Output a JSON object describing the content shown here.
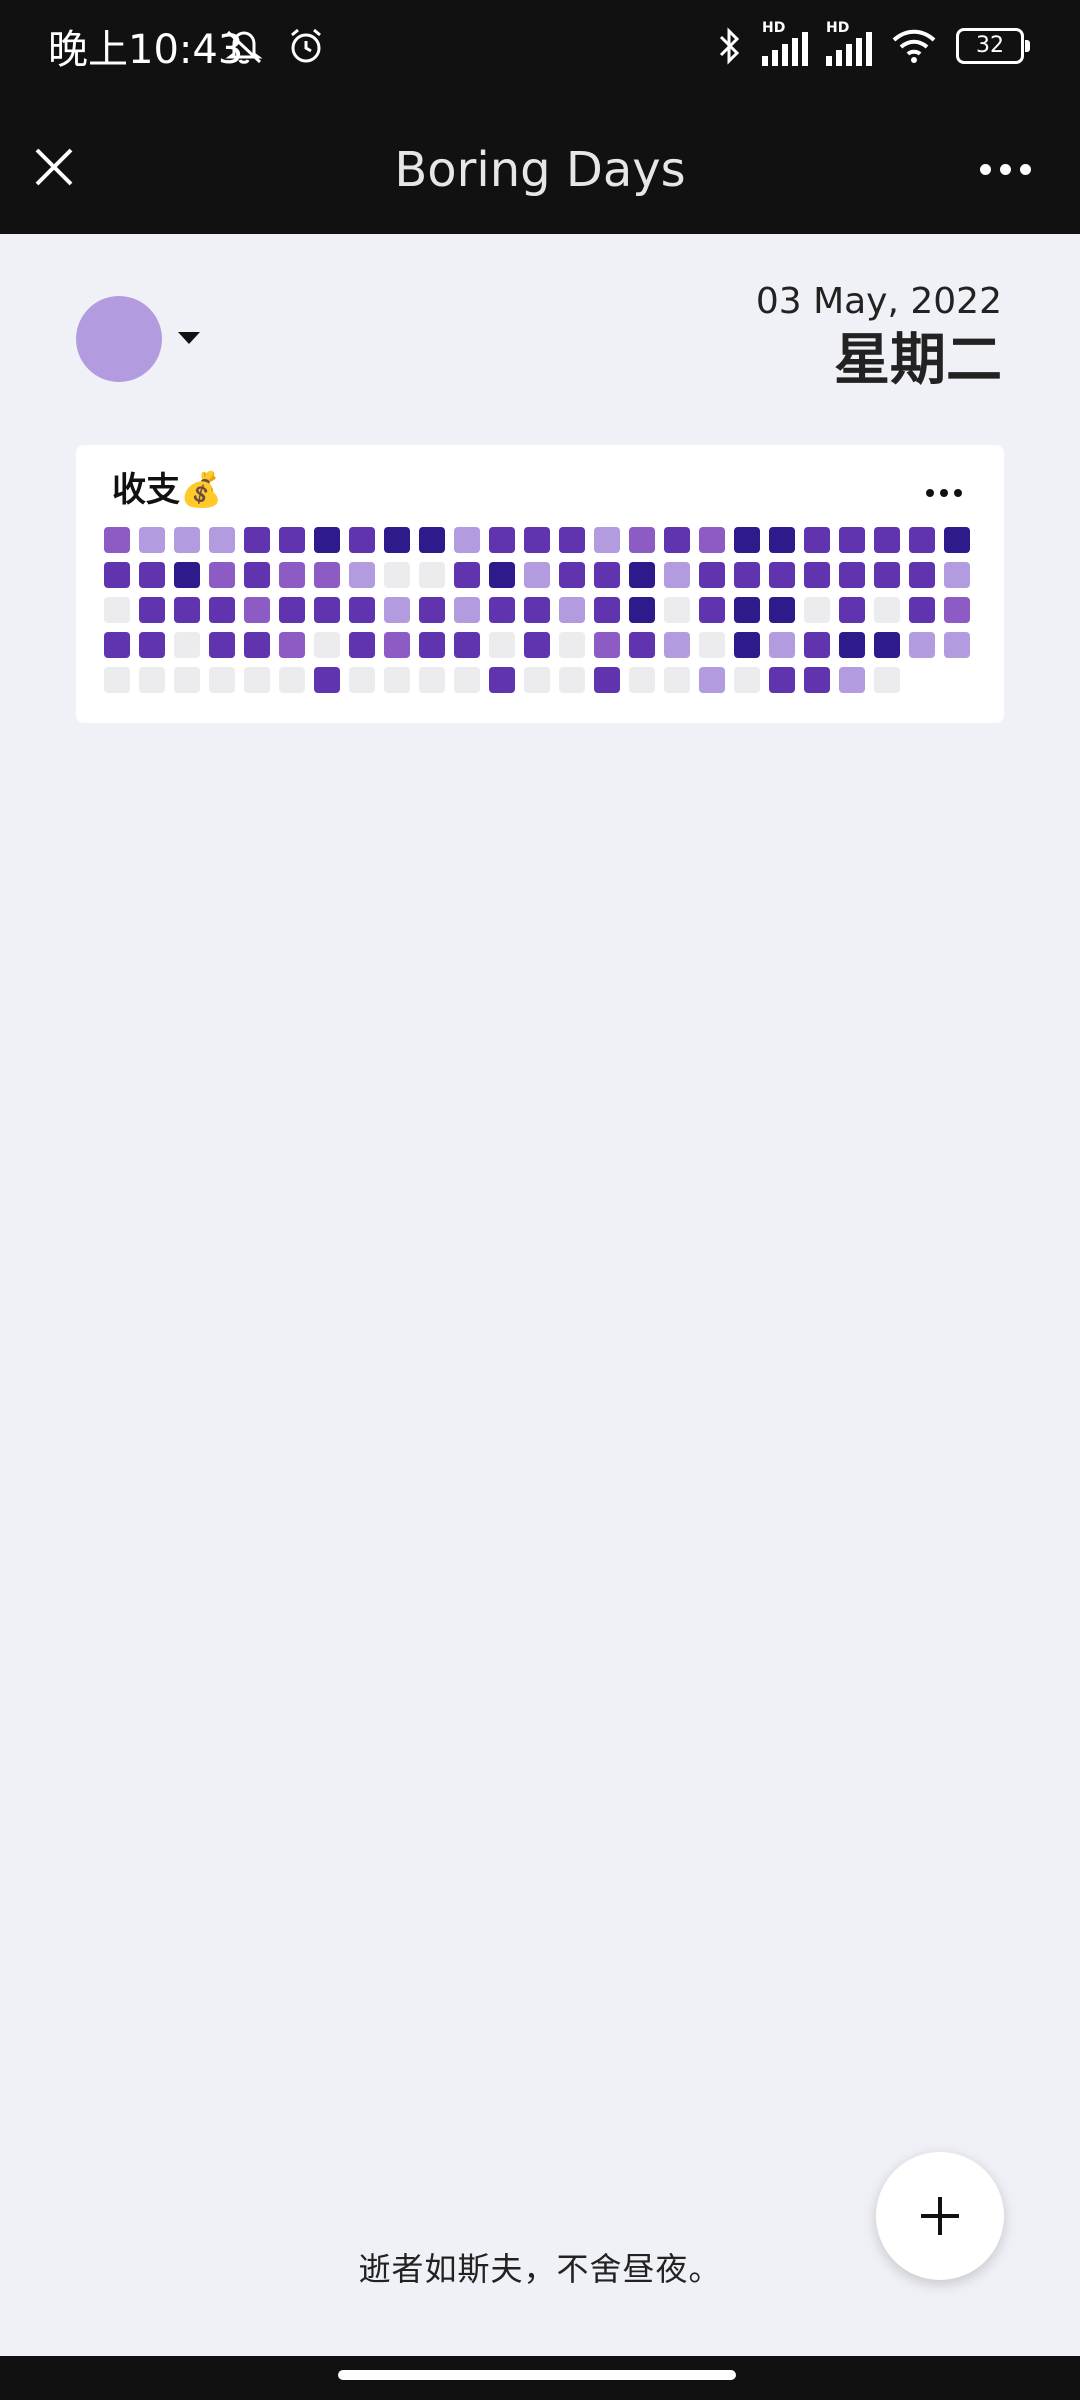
{
  "status_bar": {
    "time": "晚上10:43",
    "left_icons": [
      "bell-muted-icon",
      "alarm-icon"
    ],
    "right_icons": [
      "bluetooth-icon",
      "signal-hd-icon",
      "signal-hd-icon",
      "wifi-icon"
    ],
    "signal_label": "HD",
    "battery": "32"
  },
  "app_bar": {
    "title": "Boring Days",
    "close_icon": "close-icon",
    "more_icon": "more-horizontal-icon"
  },
  "header": {
    "avatar_color": "#b29bde",
    "date": "03 May, 2022",
    "weekday": "星期二"
  },
  "card": {
    "title": "收支💰",
    "more_icon": "more-horizontal-icon",
    "palette": [
      "#ececef",
      "#b29bde",
      "#8c5cc4",
      "#6034ae",
      "#2e1a8a"
    ],
    "rows": [
      [
        2,
        1,
        1,
        1,
        3,
        3,
        4,
        3,
        4,
        4,
        1,
        3,
        3,
        3,
        1,
        2,
        3,
        2,
        4,
        4,
        3,
        3,
        3,
        3,
        4
      ],
      [
        3,
        3,
        4,
        2,
        3,
        2,
        2,
        1,
        0,
        0,
        3,
        4,
        1,
        3,
        3,
        4,
        1,
        3,
        3,
        3,
        3,
        3,
        3,
        3,
        1
      ],
      [
        0,
        3,
        3,
        3,
        2,
        3,
        3,
        3,
        1,
        3,
        1,
        3,
        3,
        1,
        3,
        4,
        0,
        3,
        4,
        4,
        0,
        3,
        0,
        3,
        2
      ],
      [
        3,
        3,
        0,
        3,
        3,
        2,
        0,
        3,
        2,
        3,
        3,
        0,
        3,
        0,
        2,
        3,
        1,
        0,
        4,
        1,
        3,
        4,
        4,
        1,
        1
      ],
      [
        0,
        0,
        0,
        0,
        0,
        0,
        3,
        0,
        0,
        0,
        0,
        3,
        0,
        0,
        3,
        0,
        0,
        1,
        0,
        3,
        3,
        1,
        0
      ]
    ]
  },
  "quote": "逝者如斯夫，不舍昼夜。",
  "fab": {
    "icon": "plus-icon"
  }
}
